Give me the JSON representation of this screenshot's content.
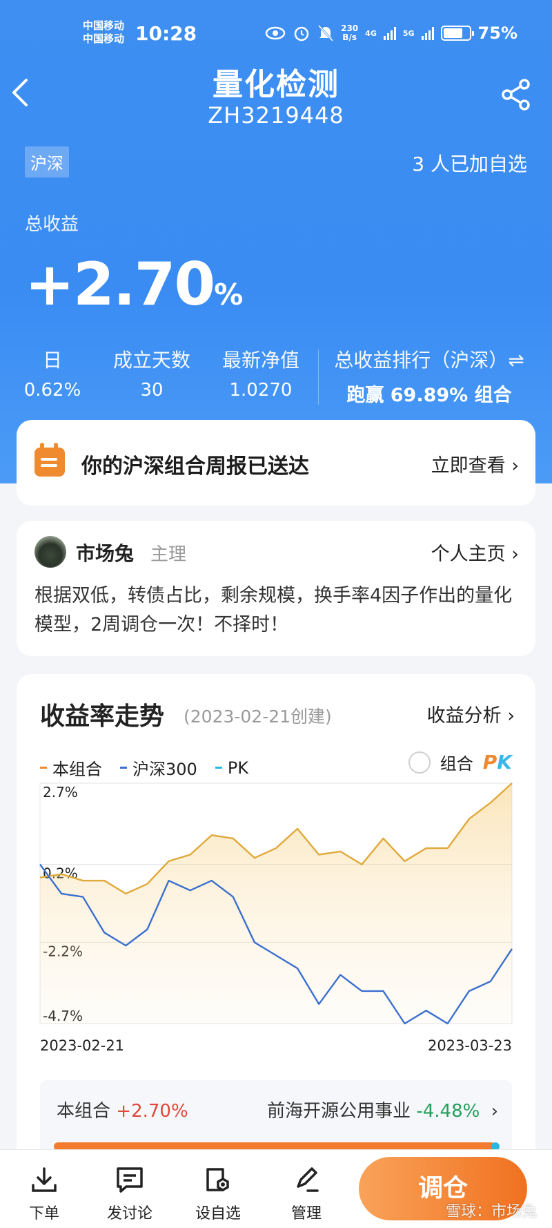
{
  "status_bar": {
    "carrier_1": "中国移动",
    "carrier_2": "中国移动",
    "time": "10:28",
    "net_speed_value": "230",
    "net_speed_unit": "B/s",
    "net_1": "4G",
    "net_2": "5G",
    "battery": "75%"
  },
  "header": {
    "title": "量化检测",
    "code": "ZH3219448",
    "back_icon": "chevron-left-icon",
    "share_icon": "share-icon"
  },
  "summary": {
    "market_tag": "沪深",
    "followers": "3 人已加自选",
    "total_gain_label": "总收益",
    "total_gain_number": "+2.70",
    "total_gain_unit": "%",
    "stats": [
      {
        "label": "日",
        "value": "0.62%"
      },
      {
        "label": "成立天数",
        "value": "30"
      },
      {
        "label": "最新净值",
        "value": "1.0270"
      }
    ],
    "ranking_label": "总收益排行（沪深）⇌",
    "ranking_value": "跑赢 69.89% 组合"
  },
  "report_card": {
    "icon": "calendar-report-icon",
    "text": "你的沪深组合周报已送达",
    "link": "立即查看 ›"
  },
  "manager_card": {
    "name": "市场兔",
    "role": "主理",
    "link": "个人主页 ›",
    "description": "根据双低，转债占比，剩余规模，换手率4因子作出的量化模型，2周调仓一次！不择时！"
  },
  "trend_card": {
    "title": "收益率走势",
    "created": "(2023-02-21创建)",
    "link": "收益分析 ›",
    "legend": [
      {
        "name": "本组合",
        "color": "#f08a2e"
      },
      {
        "name": "沪深300",
        "color": "#3a6fd0"
      },
      {
        "name": "PK",
        "color": "#28b8e0"
      }
    ],
    "pk_toggle_label": "组合",
    "pk_logo_p": "P",
    "pk_logo_k": "K",
    "start_date": "2023-02-21",
    "end_date": "2023-03-23",
    "pk_compare": {
      "left_label": "本组合",
      "left_value": "+2.70%",
      "right_label": "前海开源公用事业",
      "right_value": "-4.48%",
      "chevron": "›"
    }
  },
  "chart_data": {
    "type": "area",
    "ylim": [
      -4.7,
      2.7
    ],
    "y_tick_labels": [
      "2.7%",
      "0.2%",
      "-2.2%",
      "-4.7%"
    ],
    "y_ticks": [
      2.7,
      0.2,
      -2.2,
      -4.7
    ],
    "x_labels": [
      "2023-02-21",
      "2023-03-23"
    ],
    "grid": true,
    "series": [
      {
        "name": "本组合",
        "color": "#e0a93a",
        "fill": true,
        "values": [
          -0.2,
          -0.1,
          -0.3,
          -0.3,
          -0.7,
          -0.4,
          0.3,
          0.5,
          1.1,
          1.0,
          0.4,
          0.7,
          1.3,
          0.5,
          0.6,
          0.2,
          1.0,
          0.3,
          0.7,
          0.7,
          1.6,
          2.1,
          2.7
        ]
      },
      {
        "name": "沪深300",
        "color": "#3a6fd0",
        "fill": false,
        "values": [
          0.2,
          -0.7,
          -0.8,
          -1.9,
          -2.3,
          -1.8,
          -0.3,
          -0.6,
          -0.3,
          -0.8,
          -2.2,
          -2.6,
          -3.0,
          -4.1,
          -3.2,
          -3.7,
          -3.7,
          -4.7,
          -4.3,
          -4.7,
          -3.7,
          -3.4,
          -2.4
        ]
      }
    ]
  },
  "tabbar": {
    "tabs": [
      {
        "label": "下单",
        "icon": "download-order-icon"
      },
      {
        "label": "发讨论",
        "icon": "chat-bubble-icon"
      },
      {
        "label": "设自选",
        "icon": "favorite-settings-icon"
      },
      {
        "label": "管理",
        "icon": "edit-pen-icon"
      }
    ],
    "primary_action": "调仓",
    "watermark": "雪球：市场兔"
  }
}
